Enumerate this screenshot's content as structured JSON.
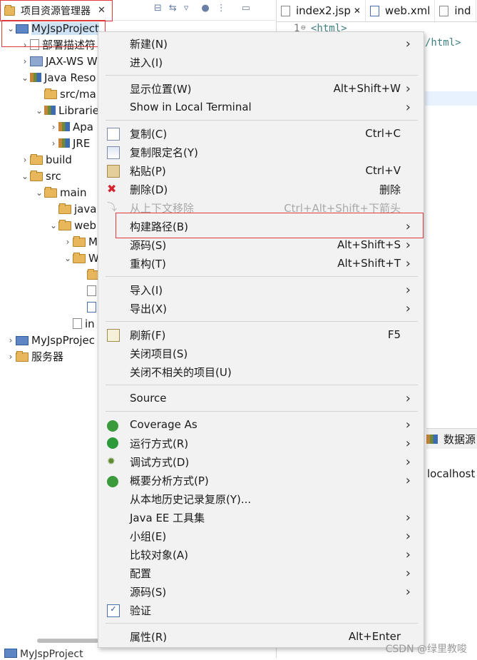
{
  "explorer": {
    "tab_title": "项目资源管理器",
    "tree": [
      {
        "label": "MyJspProject",
        "indent": 0,
        "twisty": "v",
        "icon": "project-error-icon"
      },
      {
        "label": "部署描述符",
        "indent": 1,
        "twisty": ">",
        "icon": "deploy-descriptor-icon"
      },
      {
        "label": "JAX-WS W",
        "indent": 1,
        "twisty": ">",
        "icon": "jaxws-icon"
      },
      {
        "label": "Java Reso",
        "indent": 1,
        "twisty": "v",
        "icon": "java-resources-icon"
      },
      {
        "label": "src/ma",
        "indent": 2,
        "twisty": "",
        "icon": "source-folder-icon"
      },
      {
        "label": "Librarie",
        "indent": 2,
        "twisty": "v",
        "icon": "libraries-icon"
      },
      {
        "label": "Apa",
        "indent": 3,
        "twisty": ">",
        "icon": "library-icon"
      },
      {
        "label": "JRE",
        "indent": 3,
        "twisty": ">",
        "icon": "library-icon"
      },
      {
        "label": "build",
        "indent": 1,
        "twisty": ">",
        "icon": "folder-icon"
      },
      {
        "label": "src",
        "indent": 1,
        "twisty": "v",
        "icon": "folder-icon"
      },
      {
        "label": "main",
        "indent": 2,
        "twisty": "v",
        "icon": "folder-icon"
      },
      {
        "label": "java",
        "indent": 3,
        "twisty": "",
        "icon": "folder-icon"
      },
      {
        "label": "web",
        "indent": 3,
        "twisty": "v",
        "icon": "folder-icon"
      },
      {
        "label": "M",
        "indent": 4,
        "twisty": ">",
        "icon": "folder-icon"
      },
      {
        "label": "W",
        "indent": 4,
        "twisty": "v",
        "icon": "folder-icon"
      },
      {
        "label": "",
        "indent": 5,
        "twisty": "",
        "icon": "folder-icon"
      },
      {
        "label": "",
        "indent": 5,
        "twisty": "",
        "icon": "file-icon"
      },
      {
        "label": "",
        "indent": 5,
        "twisty": "",
        "icon": "xml-file-icon"
      },
      {
        "label": "in",
        "indent": 4,
        "twisty": "",
        "icon": "file-icon"
      },
      {
        "label": "MyJspProjec",
        "indent": 0,
        "twisty": ">",
        "icon": "project-icon"
      },
      {
        "label": "服务器",
        "indent": 0,
        "twisty": ">",
        "icon": "servers-folder-icon"
      }
    ],
    "bottom_label": "MyJspProject"
  },
  "editor": {
    "tabs": [
      {
        "label": "index2.jsp",
        "icon": "jsp-file-icon",
        "close": "✕"
      },
      {
        "label": "web.xml",
        "icon": "xml-file-icon",
        "close": ""
      },
      {
        "label": "ind",
        "icon": "jsp-file-icon",
        "close": ""
      }
    ],
    "line_number": "1",
    "code_line_1": "<html>",
    "code_line_2": "/html>",
    "panel_tab_label": "数据源",
    "panel_row": "localhost"
  },
  "context_menu": {
    "items": [
      {
        "label": "新建(N)",
        "shortcut": "",
        "submenu": true,
        "icon": "",
        "disabled": false
      },
      {
        "label": "进入(I)",
        "shortcut": "",
        "submenu": false,
        "icon": "",
        "disabled": false
      },
      {
        "sep": true
      },
      {
        "label": "显示位置(W)",
        "shortcut": "Alt+Shift+W",
        "submenu": true,
        "icon": "",
        "disabled": false
      },
      {
        "label": "Show in Local Terminal",
        "shortcut": "",
        "submenu": true,
        "icon": "",
        "disabled": false
      },
      {
        "sep": true
      },
      {
        "label": "复制(C)",
        "shortcut": "Ctrl+C",
        "submenu": false,
        "icon": "copy-icon",
        "disabled": false
      },
      {
        "label": "复制限定名(Y)",
        "shortcut": "",
        "submenu": false,
        "icon": "copy-qualified-name-icon",
        "disabled": false
      },
      {
        "label": "粘贴(P)",
        "shortcut": "Ctrl+V",
        "submenu": false,
        "icon": "paste-icon",
        "disabled": false
      },
      {
        "label": "删除(D)",
        "shortcut": "删除",
        "submenu": false,
        "icon": "delete-icon",
        "disabled": false
      },
      {
        "label": "从上下文移除",
        "shortcut": "Ctrl+Alt+Shift+下箭头",
        "submenu": false,
        "icon": "remove-from-context-icon",
        "disabled": true
      },
      {
        "label": "构建路径(B)",
        "shortcut": "",
        "submenu": true,
        "icon": "",
        "disabled": false
      },
      {
        "label": "源码(S)",
        "shortcut": "Alt+Shift+S",
        "submenu": true,
        "icon": "",
        "disabled": false
      },
      {
        "label": "重构(T)",
        "shortcut": "Alt+Shift+T",
        "submenu": true,
        "icon": "",
        "disabled": false
      },
      {
        "sep": true
      },
      {
        "label": "导入(I)",
        "shortcut": "",
        "submenu": true,
        "icon": "",
        "disabled": false
      },
      {
        "label": "导出(X)",
        "shortcut": "",
        "submenu": true,
        "icon": "",
        "disabled": false
      },
      {
        "sep": true
      },
      {
        "label": "刷新(F)",
        "shortcut": "F5",
        "submenu": false,
        "icon": "refresh-icon",
        "disabled": false
      },
      {
        "label": "关闭项目(S)",
        "shortcut": "",
        "submenu": false,
        "icon": "",
        "disabled": false
      },
      {
        "label": "关闭不相关的项目(U)",
        "shortcut": "",
        "submenu": false,
        "icon": "",
        "disabled": false
      },
      {
        "sep": true
      },
      {
        "label": "Source",
        "shortcut": "",
        "submenu": true,
        "icon": "",
        "disabled": false
      },
      {
        "sep": true
      },
      {
        "label": "Coverage As",
        "shortcut": "",
        "submenu": true,
        "icon": "coverage-icon",
        "disabled": false
      },
      {
        "label": "运行方式(R)",
        "shortcut": "",
        "submenu": true,
        "icon": "run-icon",
        "disabled": false
      },
      {
        "label": "调试方式(D)",
        "shortcut": "",
        "submenu": true,
        "icon": "debug-icon",
        "disabled": false
      },
      {
        "label": "概要分析方式(P)",
        "shortcut": "",
        "submenu": true,
        "icon": "profile-icon",
        "disabled": false
      },
      {
        "label": "从本地历史记录复原(Y)...",
        "shortcut": "",
        "submenu": false,
        "icon": "",
        "disabled": false
      },
      {
        "label": "Java EE 工具集",
        "shortcut": "",
        "submenu": true,
        "icon": "",
        "disabled": false
      },
      {
        "label": "小组(E)",
        "shortcut": "",
        "submenu": true,
        "icon": "",
        "disabled": false
      },
      {
        "label": "比较对象(A)",
        "shortcut": "",
        "submenu": true,
        "icon": "",
        "disabled": false
      },
      {
        "label": "配置",
        "shortcut": "",
        "submenu": true,
        "icon": "",
        "disabled": false
      },
      {
        "label": "源码(S)",
        "shortcut": "",
        "submenu": true,
        "icon": "",
        "disabled": false
      },
      {
        "label": "验证",
        "shortcut": "",
        "submenu": false,
        "icon": "validate-checkbox-icon",
        "disabled": false
      },
      {
        "sep": true
      },
      {
        "label": "属性(R)",
        "shortcut": "Alt+Enter",
        "submenu": false,
        "icon": "",
        "disabled": false
      }
    ]
  },
  "watermark": "CSDN @绿里教唆",
  "colors": {
    "highlight_border": "#e0393e",
    "menu_background": "#f2f2f2",
    "selection": "#cfe3f7"
  }
}
